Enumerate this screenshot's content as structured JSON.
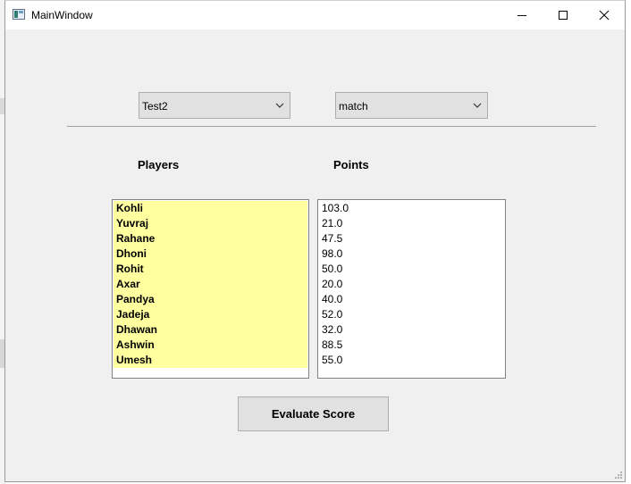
{
  "window": {
    "title": "MainWindow"
  },
  "controls": {
    "match_select": {
      "value": "Test2"
    },
    "type_select": {
      "value": "match"
    }
  },
  "columns": {
    "players_label": "Players",
    "points_label": "Points"
  },
  "players": [
    "Kohli",
    "Yuvraj",
    "Rahane",
    "Dhoni",
    "Rohit",
    "Axar",
    "Pandya",
    "Jadeja",
    "Dhawan",
    "Ashwin",
    "Umesh"
  ],
  "points": [
    "103.0",
    "21.0",
    "47.5",
    "98.0",
    "50.0",
    "20.0",
    "40.0",
    "52.0",
    "32.0",
    "88.5",
    "55.0"
  ],
  "actions": {
    "evaluate_label": "Evaluate Score"
  },
  "colors": {
    "players_highlight": "#ffffa0",
    "window_bg": "#f0f0f0",
    "button_bg": "#e1e1e1"
  },
  "icons": [
    "app-icon",
    "minimize-icon",
    "maximize-icon",
    "close-icon",
    "chevron-down-icon",
    "resize-grip-icon"
  ]
}
